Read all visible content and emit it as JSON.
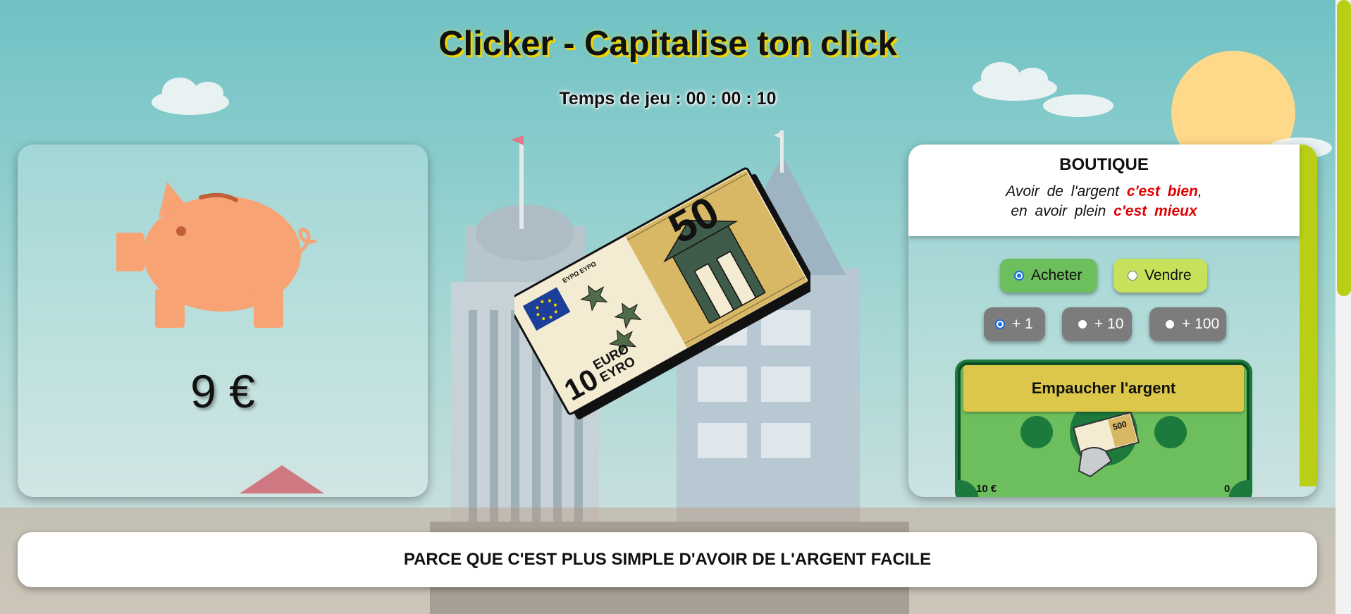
{
  "header": {
    "title": "Clicker - Capitalise ton click"
  },
  "timer": {
    "label": "Temps de jeu : 00 : 00 : 10"
  },
  "bank": {
    "balance": "9 €"
  },
  "clicker": {
    "bill_top_text": "EYPΩ ΕΥΡΩ",
    "bill_value": "50",
    "bill_euro_lines": [
      "EURO",
      "EYRO"
    ],
    "bill_prefix": "10"
  },
  "shop": {
    "title": "BOUTIQUE",
    "slogan_line1_prefix": "Avoir de l'argent ",
    "slogan_line1_emph": "c'est bien",
    "slogan_line1_suffix": ",",
    "slogan_line2_prefix": "en avoir plein ",
    "slogan_line2_emph": "c'est mieux",
    "mode_buy": "Acheter",
    "mode_sell": "Vendre",
    "selected_mode": "Acheter",
    "qty_1": "+ 1",
    "qty_10": "+ 10",
    "qty_100": "+ 100",
    "selected_qty": "+ 1",
    "item": {
      "name": "Empaucher l'argent",
      "cost": "10 €",
      "owned": "0",
      "icon_value": "500"
    }
  },
  "footer": {
    "text": "PARCE QUE C'EST PLUS SIMPLE D'AVOIR DE L'ARGENT FACILE"
  },
  "colors": {
    "accent": "#b8cf16",
    "title_glow": "#f2d400",
    "slogan_emph": "#e00000",
    "buy_button": "#6cbf5c",
    "sell_button": "#c7e25a",
    "item_card": "#1d7a3d",
    "item_button": "#dcc74a",
    "pig": "#f8a374"
  }
}
